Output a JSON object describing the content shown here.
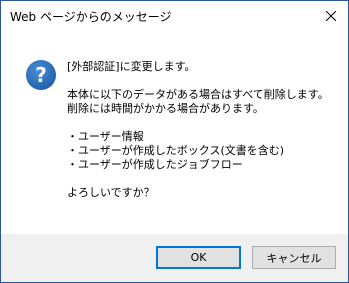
{
  "window": {
    "title": "Web ページからのメッセージ"
  },
  "icons": {
    "close": "close-icon",
    "message": "question-icon",
    "accent_color": "#2b65b0"
  },
  "message": {
    "lines": [
      "[外部認証]に変更します。",
      "",
      "本体に以下のデータがある場合はすべて削除します。",
      "削除には時間がかかる場合があります。",
      "",
      "・ユーザー情報",
      "・ユーザーが作成したボックス(文書を含む)",
      "・ユーザーが作成したジョブフロー",
      "",
      "よろしいですか？"
    ]
  },
  "buttons": {
    "ok_label": "OK",
    "cancel_label": "キャンセル"
  }
}
